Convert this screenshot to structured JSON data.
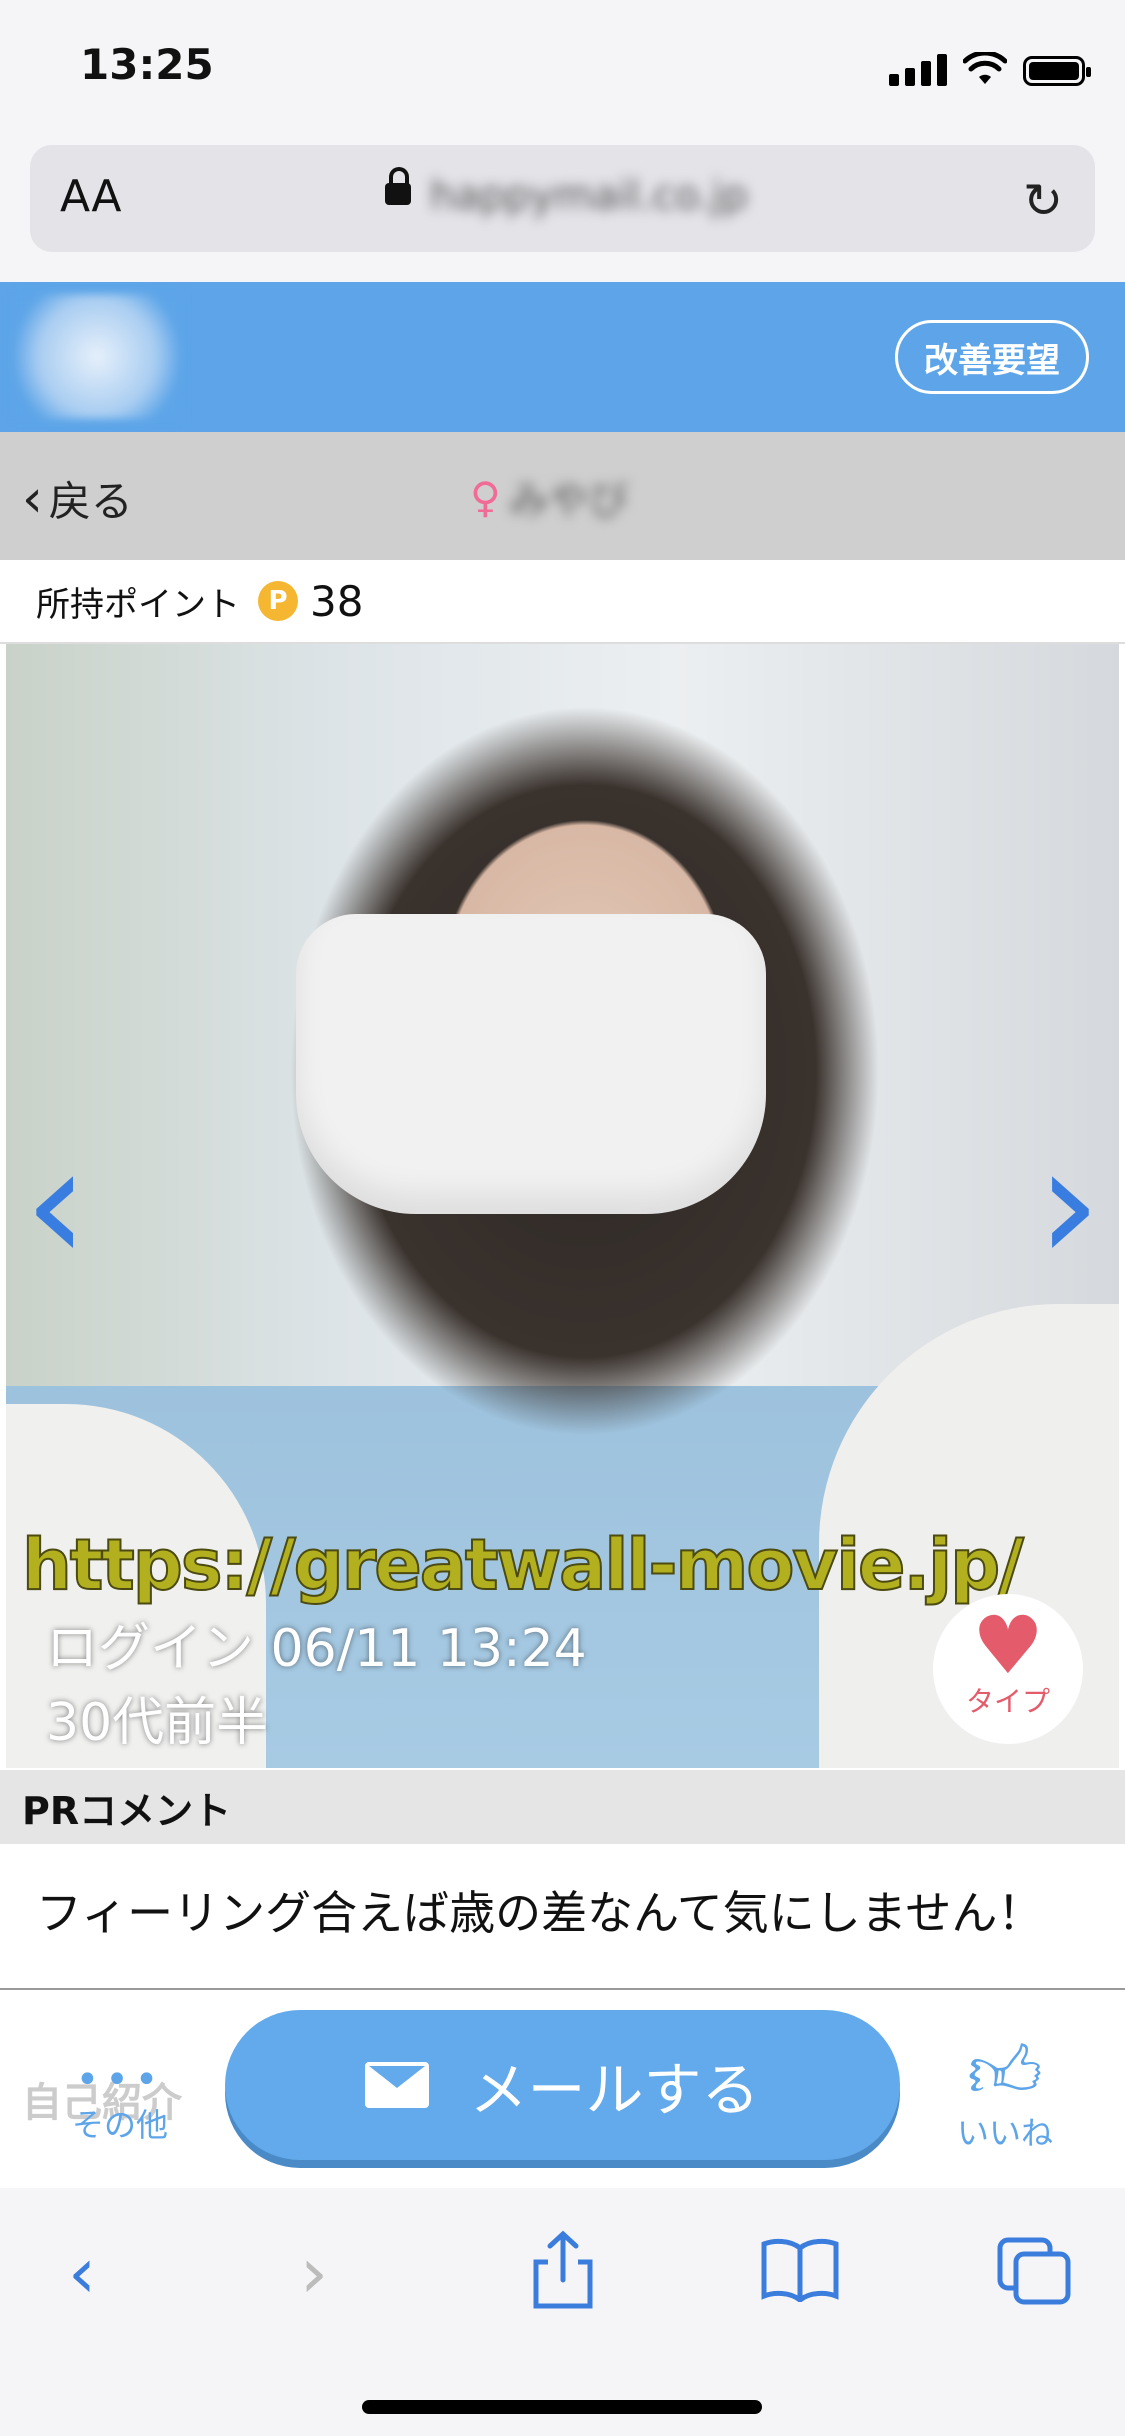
{
  "status_bar": {
    "time": "13:25"
  },
  "url_bar": {
    "aa_label": "AA",
    "domain": "happymail.co.jp"
  },
  "site_header": {
    "improve_label": "改善要望"
  },
  "nav": {
    "back_label": "戻る",
    "title_icon": "♀",
    "title_name": "みやび"
  },
  "points": {
    "label": "所持ポイント",
    "badge": "P",
    "value": "38"
  },
  "photo": {
    "watermark": "https://greatwall-movie.jp/",
    "login": "ログイン 06/11 13:24",
    "age": "30代前半",
    "like_label": "タイプ"
  },
  "pr": {
    "header": "PRコメント",
    "text": "フィーリング合えば歳の差なんて気にしません！"
  },
  "action_bar": {
    "under_text": "自己紹介",
    "other_label": "その他",
    "mail_label": "メールする",
    "like_label": "いいね"
  },
  "safari_toolbar": [
    "back-icon",
    "forward-icon",
    "share-icon",
    "bookmarks-icon",
    "tabs-icon"
  ],
  "colors": {
    "brand": "#5da5e8",
    "accent_pink": "#e45b6b",
    "point_gold": "#f5b731"
  }
}
